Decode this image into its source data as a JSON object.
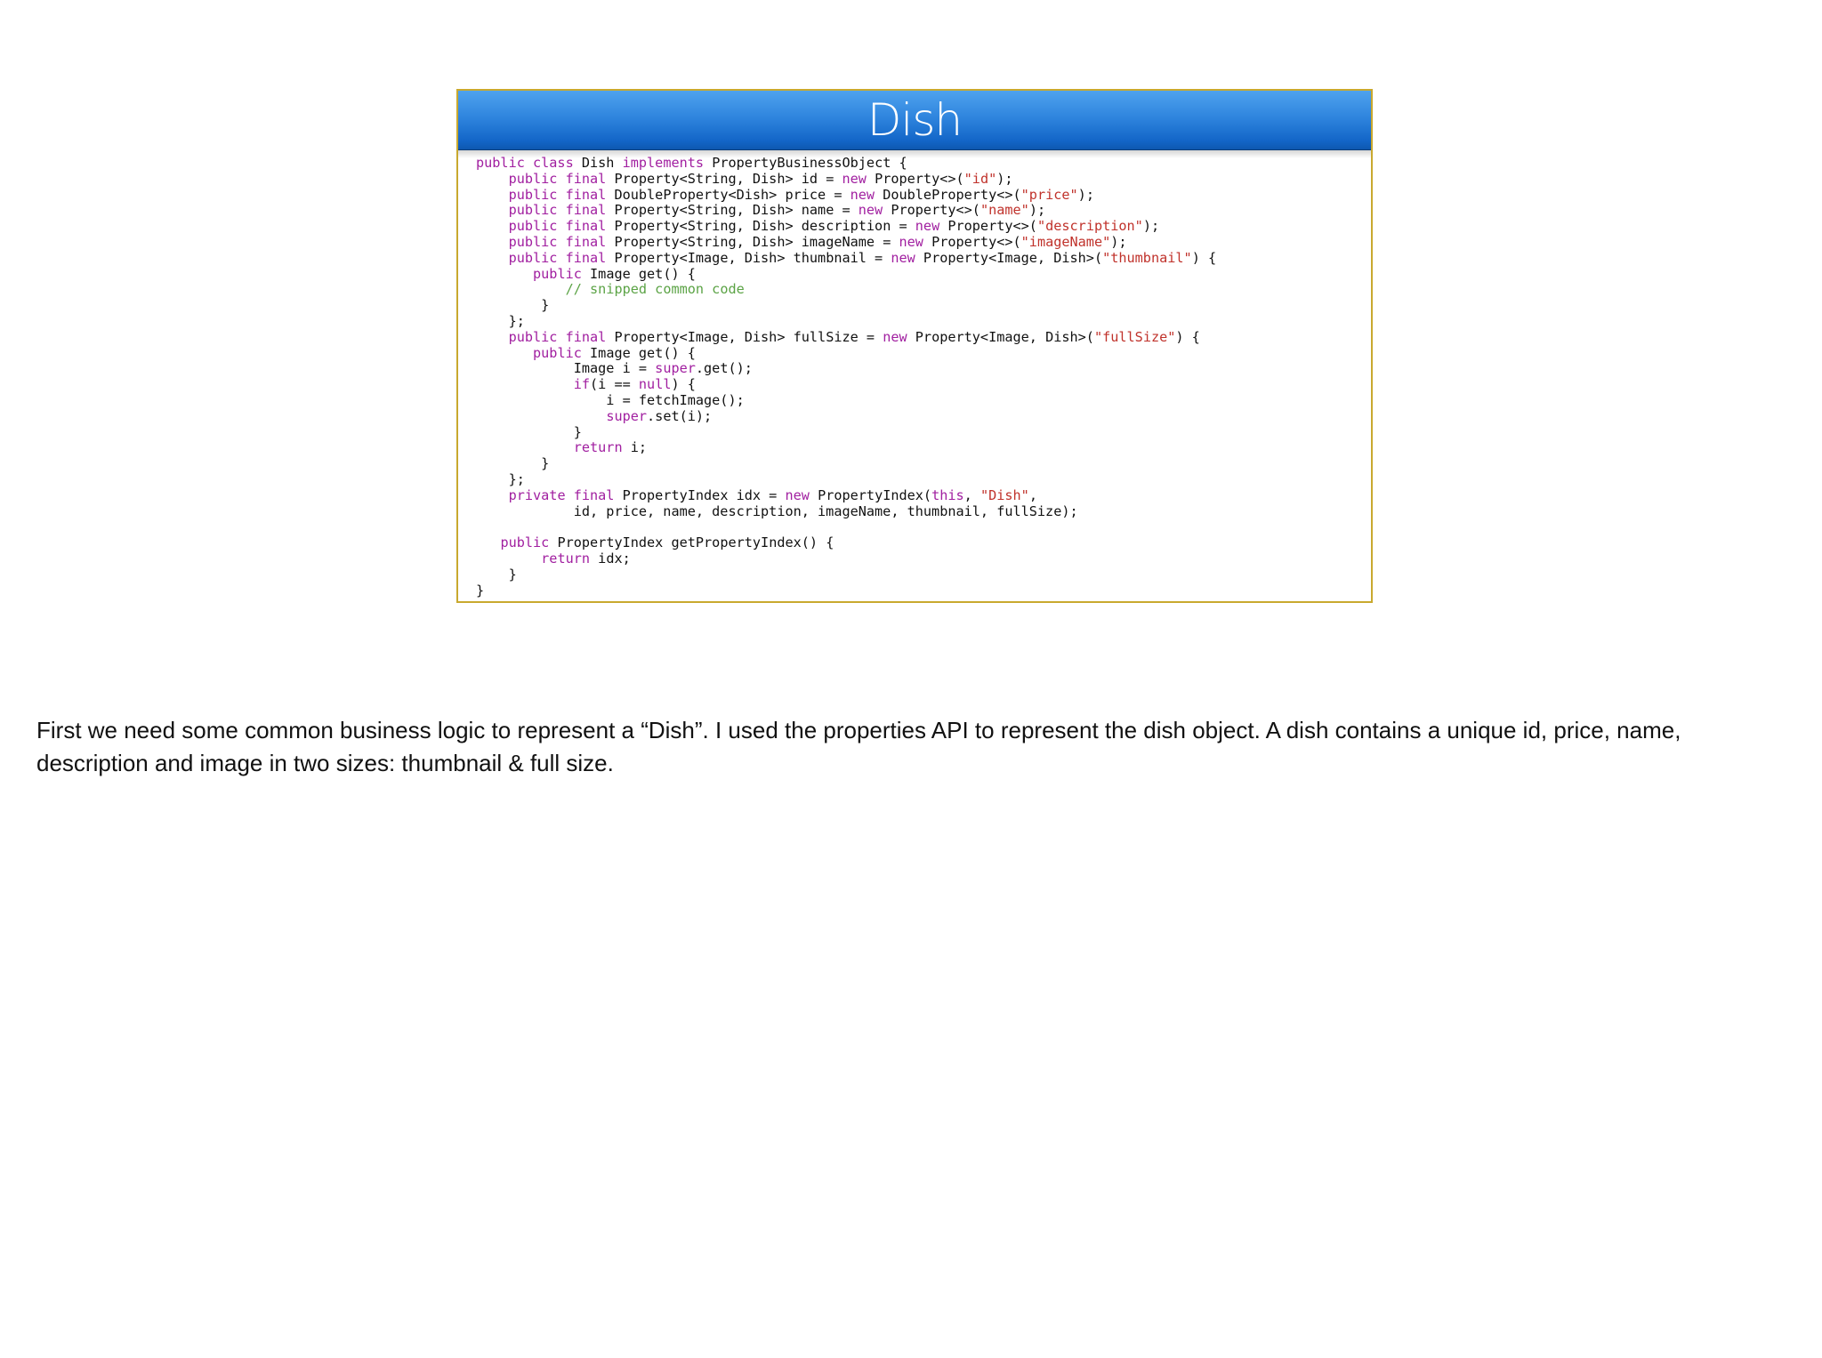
{
  "slide": {
    "title": "Dish",
    "code_lines": [
      [
        {
          "t": "public class",
          "c": "kw"
        },
        {
          "t": " Dish ",
          "c": "pl"
        },
        {
          "t": "implements",
          "c": "kw"
        },
        {
          "t": " PropertyBusinessObject {",
          "c": "pl"
        }
      ],
      [
        {
          "t": "    ",
          "c": "pl"
        },
        {
          "t": "public final",
          "c": "kw"
        },
        {
          "t": " Property<String, Dish> id = ",
          "c": "pl"
        },
        {
          "t": "new",
          "c": "kw"
        },
        {
          "t": " Property<>(",
          "c": "pl"
        },
        {
          "t": "\"id\"",
          "c": "str"
        },
        {
          "t": ");",
          "c": "pl"
        }
      ],
      [
        {
          "t": "    ",
          "c": "pl"
        },
        {
          "t": "public final",
          "c": "kw"
        },
        {
          "t": " DoubleProperty<Dish> price = ",
          "c": "pl"
        },
        {
          "t": "new",
          "c": "kw"
        },
        {
          "t": " DoubleProperty<>(",
          "c": "pl"
        },
        {
          "t": "\"price\"",
          "c": "str"
        },
        {
          "t": ");",
          "c": "pl"
        }
      ],
      [
        {
          "t": "    ",
          "c": "pl"
        },
        {
          "t": "public final",
          "c": "kw"
        },
        {
          "t": " Property<String, Dish> name = ",
          "c": "pl"
        },
        {
          "t": "new",
          "c": "kw"
        },
        {
          "t": " Property<>(",
          "c": "pl"
        },
        {
          "t": "\"name\"",
          "c": "str"
        },
        {
          "t": ");",
          "c": "pl"
        }
      ],
      [
        {
          "t": "    ",
          "c": "pl"
        },
        {
          "t": "public final",
          "c": "kw"
        },
        {
          "t": " Property<String, Dish> description = ",
          "c": "pl"
        },
        {
          "t": "new",
          "c": "kw"
        },
        {
          "t": " Property<>(",
          "c": "pl"
        },
        {
          "t": "\"description\"",
          "c": "str"
        },
        {
          "t": ");",
          "c": "pl"
        }
      ],
      [
        {
          "t": "    ",
          "c": "pl"
        },
        {
          "t": "public final",
          "c": "kw"
        },
        {
          "t": " Property<String, Dish> imageName = ",
          "c": "pl"
        },
        {
          "t": "new",
          "c": "kw"
        },
        {
          "t": " Property<>(",
          "c": "pl"
        },
        {
          "t": "\"imageName\"",
          "c": "str"
        },
        {
          "t": ");",
          "c": "pl"
        }
      ],
      [
        {
          "t": "    ",
          "c": "pl"
        },
        {
          "t": "public final",
          "c": "kw"
        },
        {
          "t": " Property<Image, Dish> thumbnail = ",
          "c": "pl"
        },
        {
          "t": "new",
          "c": "kw"
        },
        {
          "t": " Property<Image, Dish>(",
          "c": "pl"
        },
        {
          "t": "\"thumbnail\"",
          "c": "str"
        },
        {
          "t": ") {",
          "c": "pl"
        }
      ],
      [
        {
          "t": "       ",
          "c": "pl"
        },
        {
          "t": "public",
          "c": "kw"
        },
        {
          "t": " Image get() {",
          "c": "pl"
        }
      ],
      [
        {
          "t": "           ",
          "c": "pl"
        },
        {
          "t": "// snipped common code",
          "c": "cm"
        }
      ],
      [
        {
          "t": "        }",
          "c": "pl"
        }
      ],
      [
        {
          "t": "    };",
          "c": "pl"
        }
      ],
      [
        {
          "t": "    ",
          "c": "pl"
        },
        {
          "t": "public final",
          "c": "kw"
        },
        {
          "t": " Property<Image, Dish> fullSize = ",
          "c": "pl"
        },
        {
          "t": "new",
          "c": "kw"
        },
        {
          "t": " Property<Image, Dish>(",
          "c": "pl"
        },
        {
          "t": "\"fullSize\"",
          "c": "str"
        },
        {
          "t": ") {",
          "c": "pl"
        }
      ],
      [
        {
          "t": "       ",
          "c": "pl"
        },
        {
          "t": "public",
          "c": "kw"
        },
        {
          "t": " Image get() {",
          "c": "pl"
        }
      ],
      [
        {
          "t": "            Image i = ",
          "c": "pl"
        },
        {
          "t": "super",
          "c": "kw"
        },
        {
          "t": ".get();",
          "c": "pl"
        }
      ],
      [
        {
          "t": "            ",
          "c": "pl"
        },
        {
          "t": "if",
          "c": "kw"
        },
        {
          "t": "(i == ",
          "c": "pl"
        },
        {
          "t": "null",
          "c": "kw"
        },
        {
          "t": ") {",
          "c": "pl"
        }
      ],
      [
        {
          "t": "                i = fetchImage();",
          "c": "pl"
        }
      ],
      [
        {
          "t": "                ",
          "c": "pl"
        },
        {
          "t": "super",
          "c": "kw"
        },
        {
          "t": ".set(i);",
          "c": "pl"
        }
      ],
      [
        {
          "t": "            }",
          "c": "pl"
        }
      ],
      [
        {
          "t": "            ",
          "c": "pl"
        },
        {
          "t": "return",
          "c": "kw"
        },
        {
          "t": " i;",
          "c": "pl"
        }
      ],
      [
        {
          "t": "        }",
          "c": "pl"
        }
      ],
      [
        {
          "t": "    };",
          "c": "pl"
        }
      ],
      [
        {
          "t": "    ",
          "c": "pl"
        },
        {
          "t": "private final",
          "c": "kw"
        },
        {
          "t": " PropertyIndex idx = ",
          "c": "pl"
        },
        {
          "t": "new",
          "c": "kw"
        },
        {
          "t": " PropertyIndex(",
          "c": "pl"
        },
        {
          "t": "this",
          "c": "kw"
        },
        {
          "t": ", ",
          "c": "pl"
        },
        {
          "t": "\"Dish\"",
          "c": "str"
        },
        {
          "t": ",",
          "c": "pl"
        }
      ],
      [
        {
          "t": "            id, price, name, description, imageName, thumbnail, fullSize);",
          "c": "pl"
        }
      ],
      [
        {
          "t": "",
          "c": "pl"
        }
      ],
      [
        {
          "t": "   ",
          "c": "pl"
        },
        {
          "t": "public",
          "c": "kw"
        },
        {
          "t": " PropertyIndex getPropertyIndex() {",
          "c": "pl"
        }
      ],
      [
        {
          "t": "        ",
          "c": "pl"
        },
        {
          "t": "return",
          "c": "kw"
        },
        {
          "t": " idx;",
          "c": "pl"
        }
      ],
      [
        {
          "t": "    }",
          "c": "pl"
        }
      ],
      [
        {
          "t": "}",
          "c": "pl"
        }
      ]
    ]
  },
  "caption": "First we need some common business logic to represent a “Dish”. I used the properties API to represent the dish object. A dish contains a unique id, price, name, description and image in two sizes: thumbnail & full size.",
  "colors": {
    "keyword": "#a11fa0",
    "string": "#c0322b",
    "comment": "#5ba345",
    "header_blue": "#1366c8",
    "slide_border": "#c9a92f"
  }
}
